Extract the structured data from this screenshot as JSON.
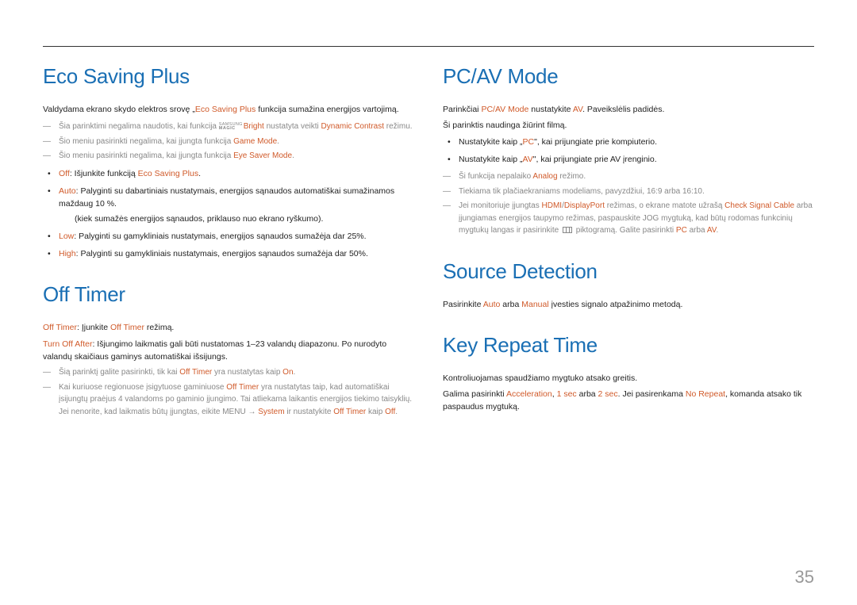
{
  "page_number": "35",
  "left": {
    "eco": {
      "title": "Eco Saving Plus",
      "intro_pre": "Valdydama ekrano skydo elektros srovę „",
      "intro_hl": "Eco Saving Plus",
      "intro_post": " funkcija sumažina energijos vartojimą.",
      "note1_a": "Šia parinktimi negalima naudotis, kai funkcija ",
      "note1_sams_top": "SAMSUNG",
      "note1_sams_bot": "MAGIC",
      "note1_b": "Bright",
      "note1_c": " nustatyta veikti ",
      "note1_d": "Dynamic Contrast",
      "note1_e": " režimu.",
      "note2_a": "Šio meniu pasirinkti negalima, kai įjungta funkcija ",
      "note2_b": "Game Mode",
      "note2_c": ".",
      "note3_a": "Šio meniu pasirinkti negalima, kai įjungta funkcija ",
      "note3_b": "Eye Saver Mode",
      "note3_c": ".",
      "b_off_a": "Off",
      "b_off_b": ": Išjunkite funkciją ",
      "b_off_c": "Eco Saving Plus",
      "b_off_d": ".",
      "b_auto_a": "Auto",
      "b_auto_b": ": Palyginti su dabartiniais nustatymais, energijos sąnaudos automatiškai sumažinamos maždaug 10 %.",
      "b_auto_sub": "(kiek sumažės energijos sąnaudos, priklauso nuo ekrano ryškumo).",
      "b_low_a": "Low",
      "b_low_b": ": Palyginti su gamykliniais nustatymais, energijos sąnaudos sumažėja dar 25%.",
      "b_high_a": "High",
      "b_high_b": ": Palyginti su gamykliniais nustatymais, energijos sąnaudos sumažėja dar 50%."
    },
    "offtimer": {
      "title": "Off Timer",
      "p1_a": "Off Timer",
      "p1_b": ": Įjunkite ",
      "p1_c": "Off Timer",
      "p1_d": " režimą.",
      "p2_a": "Turn Off After",
      "p2_b": ": Išjungimo laikmatis gali būti nustatomas 1–23 valandų diapazonu. Po nurodyto valandų skaičiaus gaminys automatiškai išsijungs.",
      "n1_a": "Šią parinktį galite pasirinkti, tik kai ",
      "n1_b": "Off Timer",
      "n1_c": " yra nustatytas kaip ",
      "n1_d": "On",
      "n1_e": ".",
      "n2_a": "Kai kuriuose regionuose įsigytuose gaminiuose ",
      "n2_b": "Off Timer",
      "n2_c": " yra nustatytas taip, kad automatiškai įsijungtų praėjus 4 valandoms po gaminio įjungimo. Tai atliekama laikantis energijos tiekimo taisyklių. Jei nenorite, kad laikmatis būtų įjungtas, eikite MENU ",
      "n2_arrow": "→",
      "n2_d": " ",
      "n2_e": "System",
      "n2_f": " ir nustatykite ",
      "n2_g": "Off Timer",
      "n2_h": " kaip ",
      "n2_i": "Off",
      "n2_j": "."
    }
  },
  "right": {
    "pcav": {
      "title": "PC/AV Mode",
      "p1_a": "Parinkčiai ",
      "p1_b": "PC/AV Mode",
      "p1_c": " nustatykite ",
      "p1_d": "AV",
      "p1_e": ". Paveikslėlis padidės.",
      "p2": "Ši parinktis naudinga žiūrint filmą.",
      "b1_a": "Nustatykite kaip „",
      "b1_b": "PC",
      "b1_c": "\", kai prijungiate prie kompiuterio.",
      "b2_a": "Nustatykite kaip „",
      "b2_b": "AV",
      "b2_c": "\", kai prijungiate prie AV įrenginio.",
      "n1_a": "Ši funkcija nepalaiko ",
      "n1_b": "Analog",
      "n1_c": " režimo.",
      "n2": "Tiekiama tik plačiaekraniams modeliams, pavyzdžiui, 16:9 arba 16:10.",
      "n3_a": "Jei monitoriuje įjungtas ",
      "n3_b": "HDMI",
      "n3_c": "/",
      "n3_d": "DisplayPort",
      "n3_e": " režimas, o ekrane matote užrašą ",
      "n3_f": "Check Signal Cable",
      "n3_g": " arba įjungiamas energijos taupymo režimas, paspauskite JOG mygtuką, kad būtų rodomas funkcinių mygtukų langas ir pasirinkite ",
      "n3_h": " piktogramą. Galite pasirinkti ",
      "n3_i": "PC",
      "n3_j": " arba ",
      "n3_k": "AV",
      "n3_l": "."
    },
    "source": {
      "title": "Source Detection",
      "p_a": "Pasirinkite ",
      "p_b": "Auto",
      "p_c": " arba ",
      "p_d": "Manual",
      "p_e": " įvesties signalo atpažinimo metodą."
    },
    "key": {
      "title": "Key Repeat Time",
      "p1": "Kontroliuojamas spaudžiamo mygtuko atsako greitis.",
      "p2_a": "Galima pasirinkti ",
      "p2_b": "Acceleration",
      "p2_c": ", ",
      "p2_d": "1 sec",
      "p2_e": " arba ",
      "p2_f": "2 sec",
      "p2_g": ". Jei pasirenkama ",
      "p2_h": "No Repeat",
      "p2_i": ", komanda atsako tik paspaudus mygtuką."
    }
  }
}
